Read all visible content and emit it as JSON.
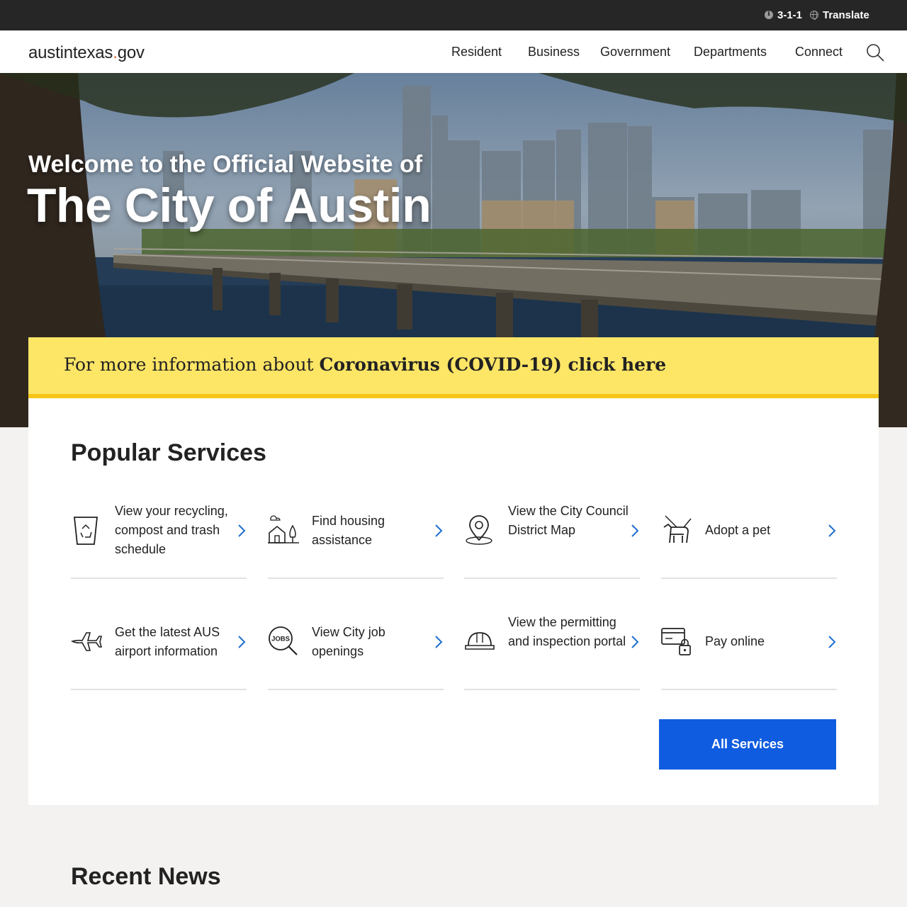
{
  "utility": {
    "phone_label": "3-1-1",
    "translate_label": "Translate"
  },
  "header": {
    "logo_main": "austintexas",
    "logo_dot": ".",
    "logo_tld": "gov",
    "nav": [
      "Resident",
      "Business",
      "Government",
      "Departments",
      "Connect"
    ]
  },
  "hero": {
    "subtitle": "Welcome to the Official Website of",
    "title": "The City of Austin"
  },
  "covid_banner": {
    "prefix": "For more information about ",
    "link": "Coronavirus (COVID-19) click here"
  },
  "services": {
    "title": "Popular Services",
    "items": [
      {
        "label": "View your recycling, compost and trash schedule",
        "icon": "recycle-bin-icon"
      },
      {
        "label": "Find housing assistance",
        "icon": "housing-icon"
      },
      {
        "label": "View the City Council District Map",
        "icon": "map-pin-icon"
      },
      {
        "label": "Adopt a pet",
        "icon": "dog-icon"
      },
      {
        "label": "Get the latest AUS airport information",
        "icon": "airplane-icon"
      },
      {
        "label": "View City job openings",
        "icon": "jobs-search-icon"
      },
      {
        "label": "View the permitting and inspection portal",
        "icon": "hard-hat-icon"
      },
      {
        "label": "Pay online",
        "icon": "credit-card-lock-icon"
      }
    ],
    "all_button": "All Services"
  },
  "news": {
    "title": "Recent News"
  },
  "colors": {
    "utility_bar": "#262626",
    "banner_yellow": "#fde566",
    "banner_border": "#f5c518",
    "button_blue": "#0f5ce0",
    "arrow_blue": "#1f6fd0",
    "page_bg": "#f3f2f0"
  }
}
